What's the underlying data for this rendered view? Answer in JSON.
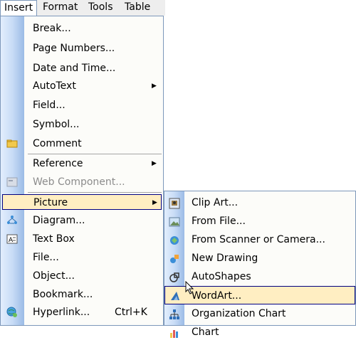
{
  "menubar": {
    "items": [
      {
        "label": "Insert"
      },
      {
        "label": "Format"
      },
      {
        "label": "Tools"
      },
      {
        "label": "Table"
      }
    ]
  },
  "insert_menu": {
    "items": [
      {
        "label": "Break..."
      },
      {
        "label": "Page Numbers..."
      },
      {
        "label": "Date and Time..."
      },
      {
        "label": "AutoText"
      },
      {
        "label": "Field..."
      },
      {
        "label": "Symbol..."
      },
      {
        "label": "Comment"
      },
      {
        "label": "Reference"
      },
      {
        "label": "Web Component..."
      },
      {
        "label": "Picture"
      },
      {
        "label": "Diagram..."
      },
      {
        "label": "Text Box"
      },
      {
        "label": "File..."
      },
      {
        "label": "Object..."
      },
      {
        "label": "Bookmark..."
      },
      {
        "label": "Hyperlink...",
        "shortcut": "Ctrl+K"
      }
    ]
  },
  "picture_submenu": {
    "items": [
      {
        "label": "Clip Art..."
      },
      {
        "label": "From File..."
      },
      {
        "label": "From Scanner or Camera..."
      },
      {
        "label": "New Drawing"
      },
      {
        "label": "AutoShapes"
      },
      {
        "label": "WordArt..."
      },
      {
        "label": "Organization Chart"
      },
      {
        "label": "Chart"
      }
    ]
  },
  "colors": {
    "highlight": "#ffeec2",
    "highlight_border": "#000080",
    "menu_border": "#7d98ba",
    "gutter": "#c8dcf6"
  }
}
